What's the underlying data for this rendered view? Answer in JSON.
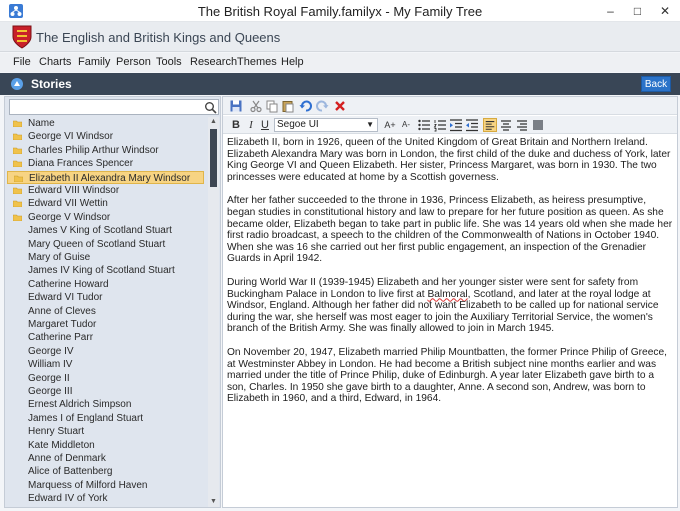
{
  "window": {
    "title": "The British Royal Family.familyx - My Family Tree",
    "minimize": "–",
    "maximize": "□",
    "close": "✕"
  },
  "banner": {
    "title": "The English and British Kings and Queens"
  },
  "menu": [
    "File",
    "Charts",
    "Family",
    "Person",
    "Tools",
    "Research",
    "Themes",
    "Help"
  ],
  "section": {
    "title": "Stories",
    "back_label": "Back"
  },
  "search": {
    "value": "",
    "placeholder": ""
  },
  "tree": [
    {
      "label": "Name",
      "type": "folder"
    },
    {
      "label": "George VI Windsor",
      "type": "folder"
    },
    {
      "label": "Charles Philip Arthur Windsor",
      "type": "folder"
    },
    {
      "label": "Diana Frances Spencer",
      "type": "folder"
    },
    {
      "label": "Elizabeth II Alexandra Mary Windsor",
      "type": "folder",
      "selected": true
    },
    {
      "label": "Edward VIII Windsor",
      "type": "folder"
    },
    {
      "label": "Edward VII Wettin",
      "type": "folder"
    },
    {
      "label": "George V Windsor",
      "type": "folder"
    },
    {
      "label": "James V King of Scotland Stuart",
      "type": "leaf"
    },
    {
      "label": "Mary Queen of Scotland Stuart",
      "type": "leaf"
    },
    {
      "label": "Mary of Guise",
      "type": "leaf"
    },
    {
      "label": "James IV King of Scotland Stuart",
      "type": "leaf"
    },
    {
      "label": "Catherine Howard",
      "type": "leaf"
    },
    {
      "label": "Edward VI Tudor",
      "type": "leaf"
    },
    {
      "label": "Anne of Cleves",
      "type": "leaf"
    },
    {
      "label": "Margaret Tudor",
      "type": "leaf"
    },
    {
      "label": "Catherine Parr",
      "type": "leaf"
    },
    {
      "label": "George IV",
      "type": "leaf"
    },
    {
      "label": "William IV",
      "type": "leaf"
    },
    {
      "label": "George II",
      "type": "leaf"
    },
    {
      "label": "George III",
      "type": "leaf"
    },
    {
      "label": "Ernest Aldrich Simpson",
      "type": "leaf"
    },
    {
      "label": "James I of England Stuart",
      "type": "leaf"
    },
    {
      "label": "Henry Stuart",
      "type": "leaf"
    },
    {
      "label": "Kate Middleton",
      "type": "leaf"
    },
    {
      "label": "Anne of Denmark",
      "type": "leaf"
    },
    {
      "label": "Alice of Battenberg",
      "type": "leaf"
    },
    {
      "label": "Marquess of Milford Haven",
      "type": "leaf"
    },
    {
      "label": "Edward IV of York",
      "type": "leaf"
    }
  ],
  "toolbar": {
    "font_name": "Segoe UI",
    "bold": "B",
    "italic": "I",
    "underline": "U",
    "grow_font": "A+",
    "shrink_font": "A-"
  },
  "story": {
    "paragraphs": [
      "Elizabeth II, born in 1926, queen of the United Kingdom of Great Britain and Northern Ireland. Elizabeth Alexandra Mary was born in London, the first child of the duke and duchess of York, later King George VI and Queen Elizabeth. Her sister, Princess Margaret, was born in 1930. The two princesses were educated at home by a Scottish governess.",
      "After her father succeeded to the throne in 1936, Princess Elizabeth, as heiress presumptive, began studies in constitutional history and law to prepare for her future position as queen. As she became older, Elizabeth began to take part in public life. She was 14 years old when she made her first radio broadcast, a speech to the children of the Commonwealth of Nations in October 1940. When she was 16 she carried out her first public engagement, an inspection of the Grenadier Guards in April 1942.",
      "During World War II (1939-1945) Elizabeth and her younger sister were sent for safety from Buckingham Palace in London to live first at ",
      "On November 20, 1947, Elizabeth married Philip Mountbatten, the former Prince Philip of Greece, at Westminster Abbey in London. He had become a British subject nine months earlier and was married under the title of Prince Philip, duke of Edinburgh. A year later Elizabeth gave birth to a son, Charles. In 1950 she gave birth to a daughter, Anne. A second son, Andrew, was born to Elizabeth in 1960, and a third, Edward, in 1964."
    ],
    "p3_misspelled": "Balmoral",
    "p3_rest": ", Scotland, and later at the royal lodge at Windsor, England. Although her father did not want Elizabeth to be called up for national service during the war, she herself was most eager to join the Auxiliary Territorial Service, the women's branch of the British Army. She was finally allowed to join in March 1945."
  },
  "colors": {
    "section_bar": "#394656",
    "back_button": "#2b73c9",
    "selection": "#f7d483",
    "delete_icon": "#d42020"
  }
}
